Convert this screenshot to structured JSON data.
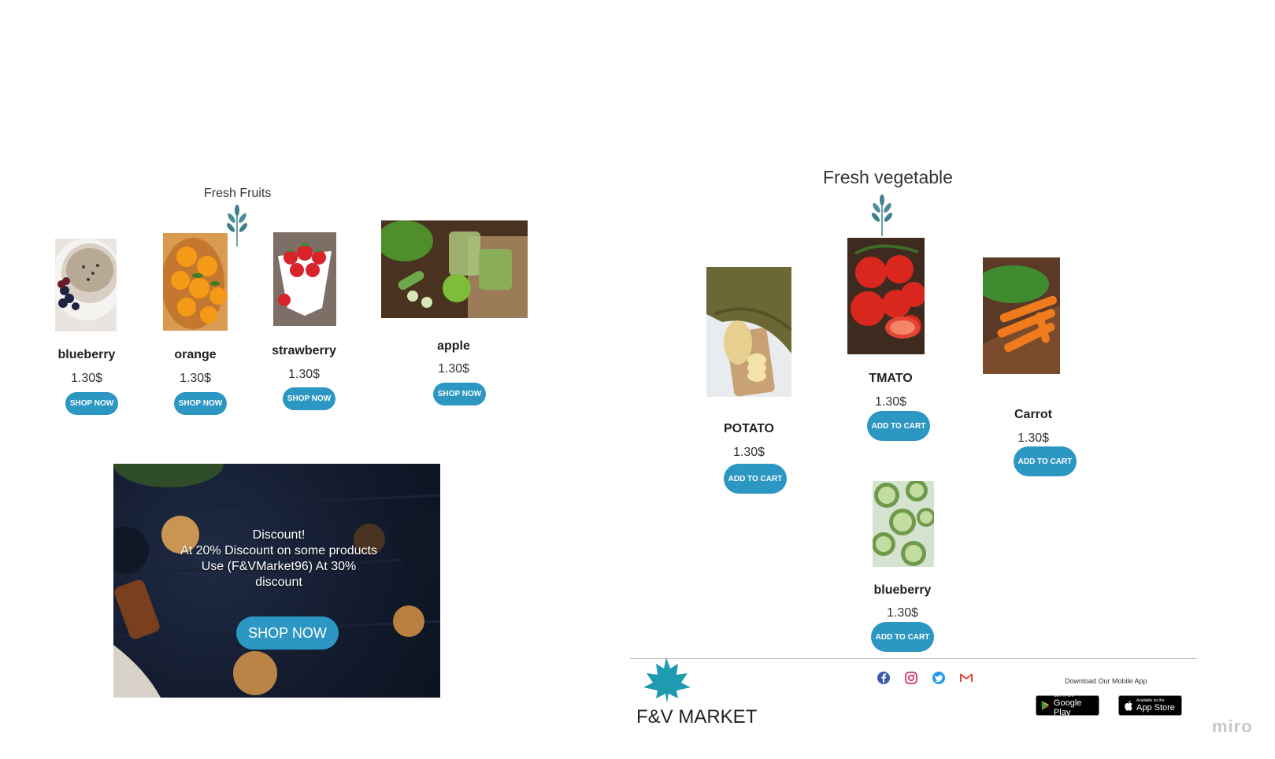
{
  "fruits": {
    "title": "Fresh Fruits",
    "items": [
      {
        "name": "blueberry",
        "price": "1.30$",
        "button": "SHOP NOW"
      },
      {
        "name": "orange",
        "price": "1.30$",
        "button": "SHOP NOW"
      },
      {
        "name": "strawberry",
        "price": "1.30$",
        "button": "SHOP NOW"
      },
      {
        "name": "apple",
        "price": "1.30$",
        "button": "SHOP NOW"
      }
    ]
  },
  "promo": {
    "text": "Discount!\nAt 20% Discount on some products\nUse (F&VMarket96) At 30% discount",
    "button": "SHOP NOW"
  },
  "vegetables": {
    "title": "Fresh vegetable",
    "items": [
      {
        "name": "POTATO",
        "price": "1.30$",
        "button": "ADD TO CART"
      },
      {
        "name": "TMATO",
        "price": "1.30$",
        "button": "ADD TO CART"
      },
      {
        "name": "Carrot",
        "price": "1.30$",
        "button": "ADD TO CART"
      },
      {
        "name": "blueberry",
        "price": "1.30$",
        "button": "ADD TO CART"
      }
    ]
  },
  "footer": {
    "brand": "F&V MARKET",
    "download_label": "Download Our Mobile App",
    "social_icons": [
      "facebook-icon",
      "instagram-icon",
      "twitter-icon",
      "gmail-icon"
    ],
    "google_play": {
      "small": "GET IT ON",
      "label": "Google Play"
    },
    "app_store": {
      "small": "Available on the",
      "label": "App Store"
    }
  },
  "watermark": "miro",
  "colors": {
    "accent": "#2c97c2",
    "leaf": "#3f7f8a",
    "brand_leaf": "#1e9bb0"
  }
}
